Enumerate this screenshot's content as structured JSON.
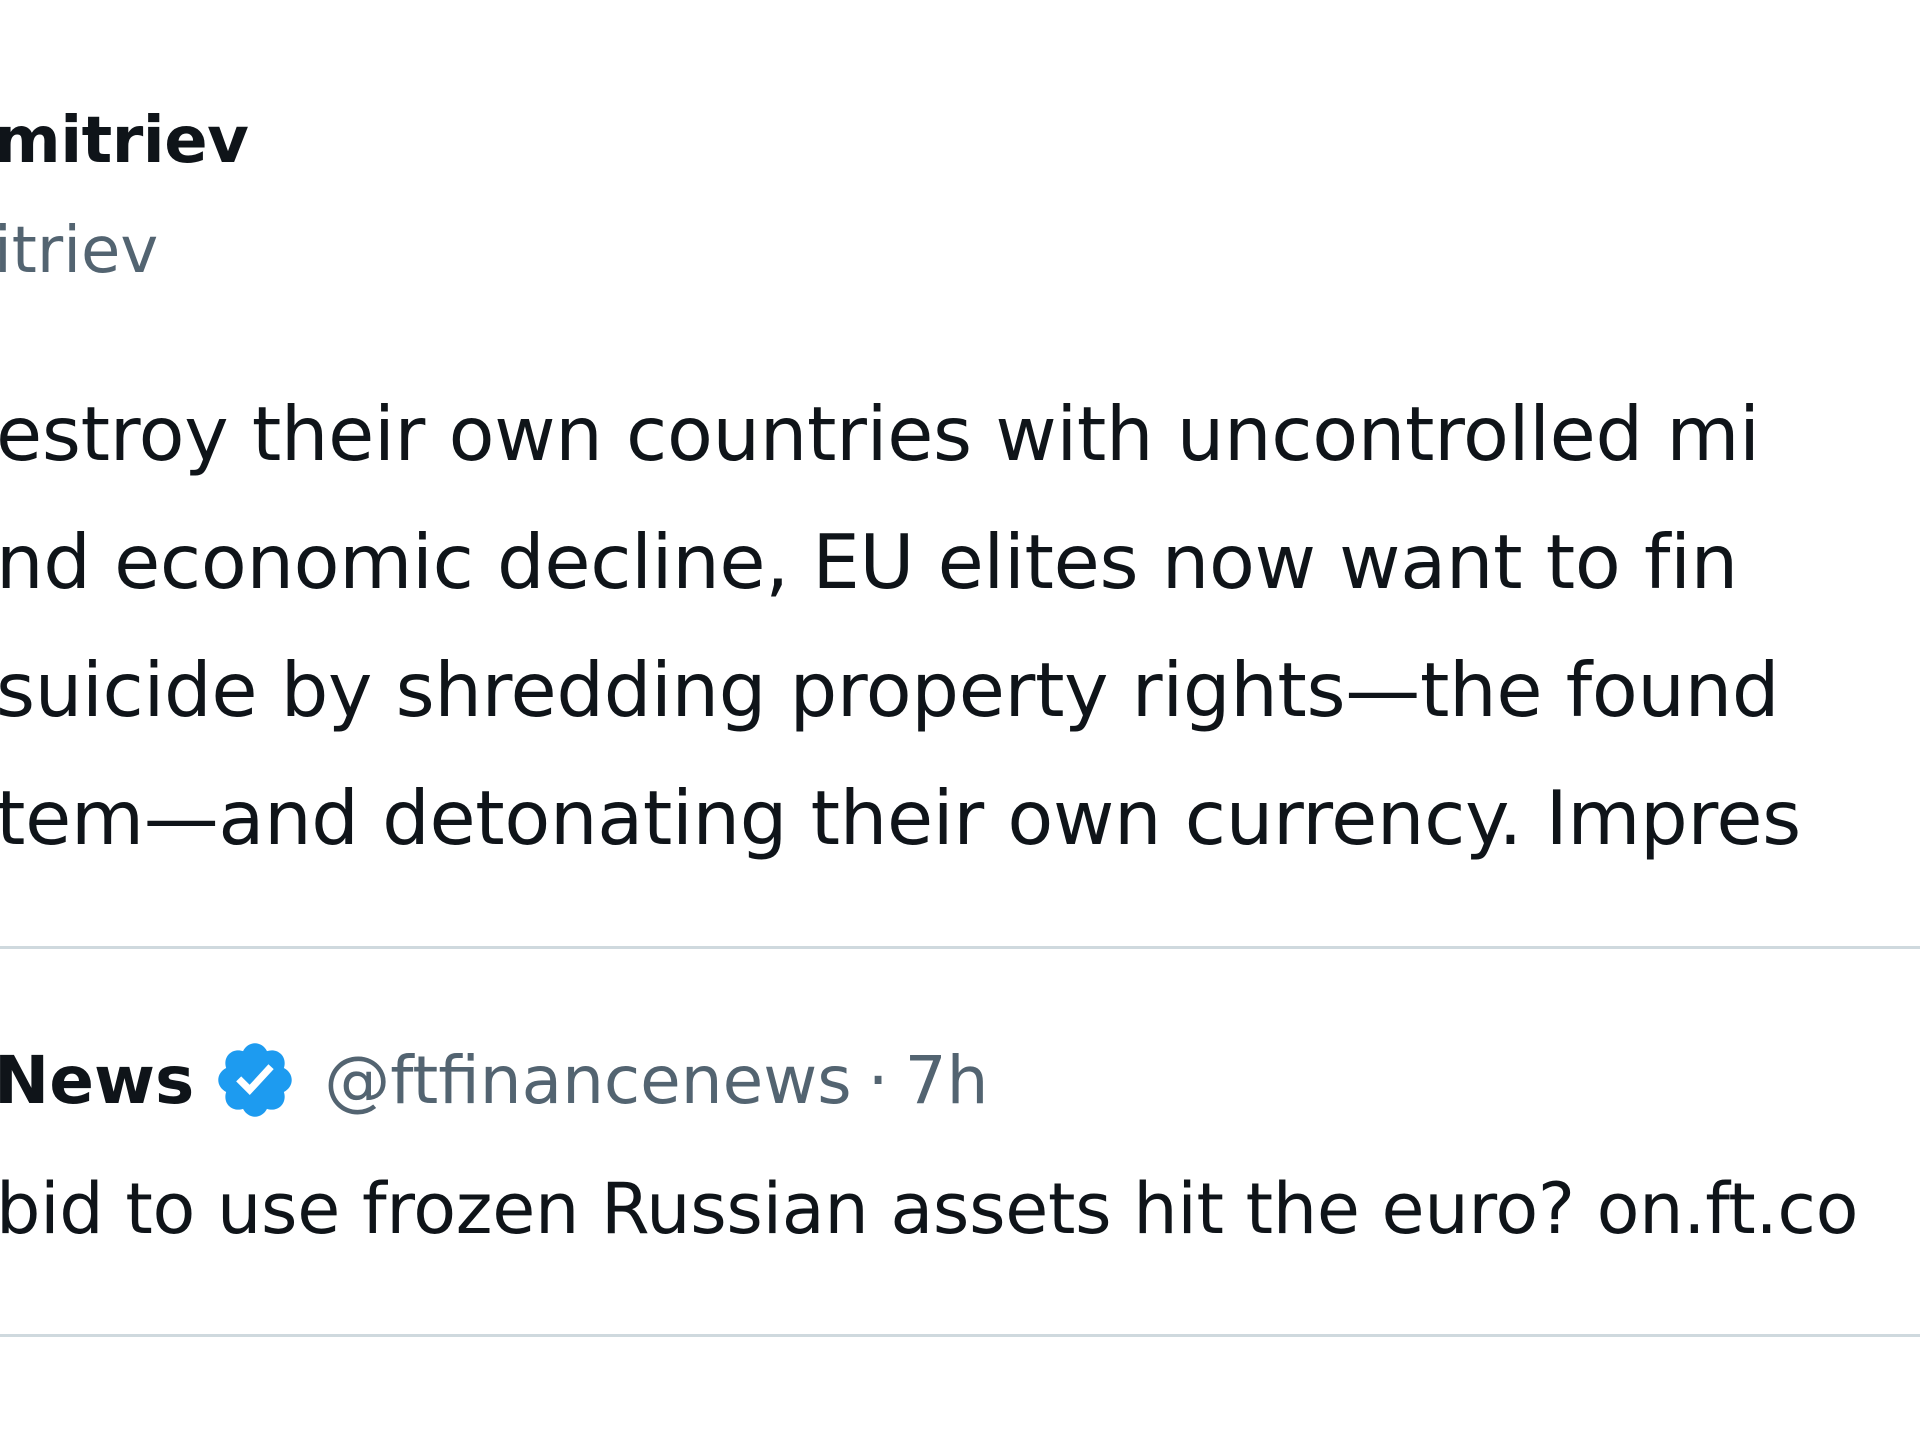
{
  "tweet": {
    "author_name": "mitriev",
    "author_handle": "itriev",
    "text_lines": [
      "estroy their own countries with uncontrolled mi",
      "nd economic decline, EU elites now want to fin",
      "suicide by shredding property rights—the found",
      "tem—and detonating their own currency. Impres"
    ]
  },
  "quoted_tweet": {
    "author_name": "News",
    "verified_icon": "verified-badge-icon",
    "handle": "@ftfinancenews",
    "separator": "·",
    "time": "7h",
    "text": "bid to use frozen Russian assets hit the euro? on.ft.co"
  },
  "colors": {
    "text_primary": "#0f1419",
    "text_secondary": "#536471",
    "verified_blue": "#1d9bf0",
    "divider": "#cfd9de"
  }
}
